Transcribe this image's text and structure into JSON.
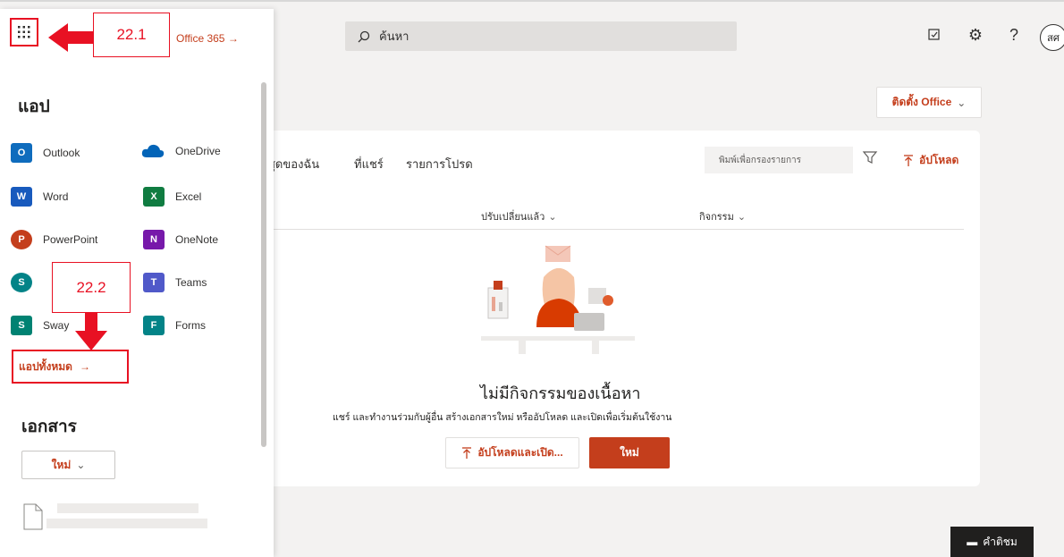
{
  "search": {
    "placeholder": "ค้นหา"
  },
  "header": {
    "avatar_initials": "สศ"
  },
  "main": {
    "install_label": "ติดตั้ง Office",
    "tabs": [
      "สุดของฉัน",
      "ที่แชร์",
      "รายการโปรด"
    ],
    "filter_placeholder": "พิมพ์เพื่อกรองรายการ",
    "upload_label": "อัปโหลด",
    "columns": [
      "ปรับเปลี่ยนแล้ว",
      "กิจกรรม"
    ],
    "empty_title": "ไม่มีกิจกรรมของเนื้อหา",
    "empty_subtitle": "แชร์ และทำงานร่วมกับผู้อื่น สร้างเอกสารใหม่ หรืออัปโหลด และเปิดเพื่อเริ่มต้นใช้งาน",
    "upload_open_label": "อัปโหลดและเปิด...",
    "new_label": "ใหม่",
    "feedback_label": "คำติชม"
  },
  "panel": {
    "office_link": "Office 365",
    "apps_heading": "แอป",
    "apps": [
      {
        "label": "Outlook",
        "icon": "outlook-icon",
        "color": "#0f6cbd",
        "letter": "O"
      },
      {
        "label": "OneDrive",
        "icon": "onedrive-icon",
        "color": "#0364b8",
        "letter": ""
      },
      {
        "label": "Word",
        "icon": "word-icon",
        "color": "#185abd",
        "letter": "W"
      },
      {
        "label": "Excel",
        "icon": "excel-icon",
        "color": "#107c41",
        "letter": "X"
      },
      {
        "label": "PowerPoint",
        "icon": "powerpoint-icon",
        "color": "#c43e1c",
        "letter": "P"
      },
      {
        "label": "OneNote",
        "icon": "onenote-icon",
        "color": "#7719aa",
        "letter": "N"
      },
      {
        "label": "Teams",
        "icon": "teams-icon",
        "color": "#5059c9",
        "letter": "T"
      },
      {
        "label": "Sway",
        "icon": "sway-icon",
        "color": "#008272",
        "letter": "S"
      },
      {
        "label": "Forms",
        "icon": "forms-icon",
        "color": "#038387",
        "letter": "F"
      }
    ],
    "sharepoint_icon_color": "#038387",
    "all_apps_label": "แอปทั้งหมด",
    "docs_heading": "เอกสาร",
    "new_doc_label": "ใหม่"
  },
  "annotations": {
    "step1": "22.1",
    "step2": "22.2",
    "accent": "#e81123"
  }
}
